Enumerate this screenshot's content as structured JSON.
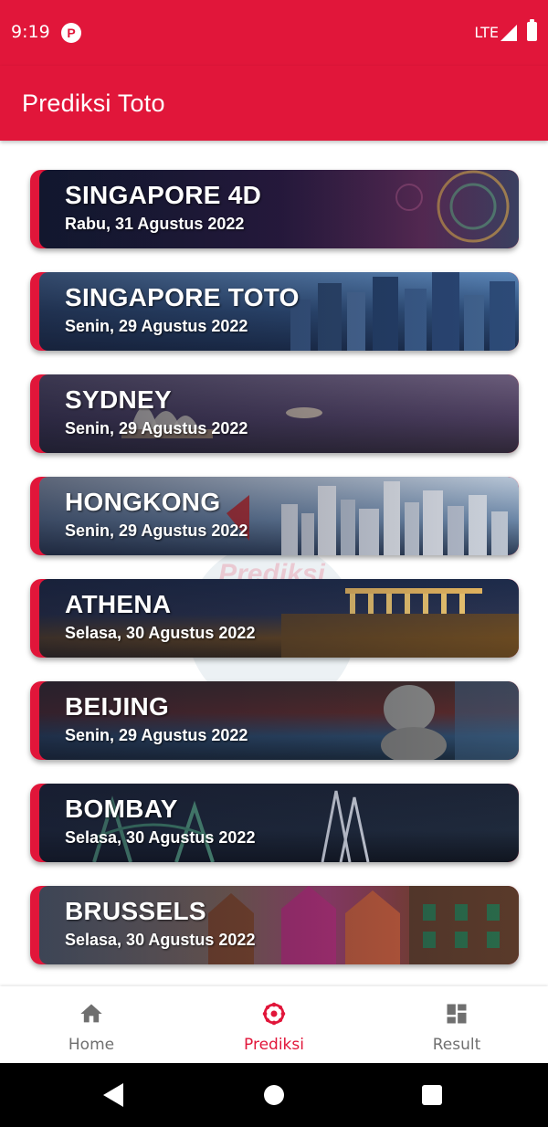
{
  "status_bar": {
    "time": "9:19",
    "network": "LTE"
  },
  "app_bar": {
    "title": "Prediksi Toto"
  },
  "watermark_text": "Prediksi",
  "markets": [
    {
      "name": "SINGAPORE 4D",
      "date": "Rabu, 31 Agustus 2022"
    },
    {
      "name": "SINGAPORE TOTO",
      "date": "Senin, 29 Agustus 2022"
    },
    {
      "name": "SYDNEY",
      "date": "Senin, 29 Agustus 2022"
    },
    {
      "name": "HONGKONG",
      "date": "Senin, 29 Agustus 2022"
    },
    {
      "name": "ATHENA",
      "date": "Selasa, 30 Agustus 2022"
    },
    {
      "name": "BEIJING",
      "date": "Senin, 29 Agustus 2022"
    },
    {
      "name": "BOMBAY",
      "date": "Selasa, 30 Agustus 2022"
    },
    {
      "name": "BRUSSELS",
      "date": "Selasa, 30 Agustus 2022"
    }
  ],
  "bottom_nav": {
    "items": [
      {
        "label": "Home",
        "icon": "home-icon",
        "active": false
      },
      {
        "label": "Prediksi",
        "icon": "prediksi-icon",
        "active": true
      },
      {
        "label": "Result",
        "icon": "dashboard-icon",
        "active": false
      }
    ]
  },
  "colors": {
    "accent": "#e1163a",
    "nav_inactive": "#6f6f6f"
  }
}
